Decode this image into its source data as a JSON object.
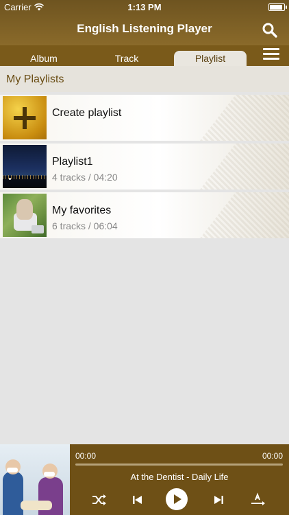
{
  "status_bar": {
    "carrier": "Carrier",
    "time": "1:13 PM"
  },
  "nav": {
    "title": "English Listening Player"
  },
  "tabs": [
    {
      "label": "Album",
      "active": false
    },
    {
      "label": "Track",
      "active": false
    },
    {
      "label": "Playlist",
      "active": true
    }
  ],
  "section": {
    "title": "My Playlists"
  },
  "playlists": [
    {
      "title": "Create playlist",
      "subtitle": ""
    },
    {
      "title": "Playlist1",
      "subtitle": "4 tracks / 04:20"
    },
    {
      "title": "My favorites",
      "subtitle": "6 tracks / 06:04"
    }
  ],
  "player": {
    "elapsed": "00:00",
    "duration": "00:00",
    "progress": 0,
    "track_title": "At the Dentist - Daily Life"
  },
  "colors": {
    "brand": "#7a5a1a",
    "background": "#e4e4e4",
    "accent": "#ffffff"
  }
}
